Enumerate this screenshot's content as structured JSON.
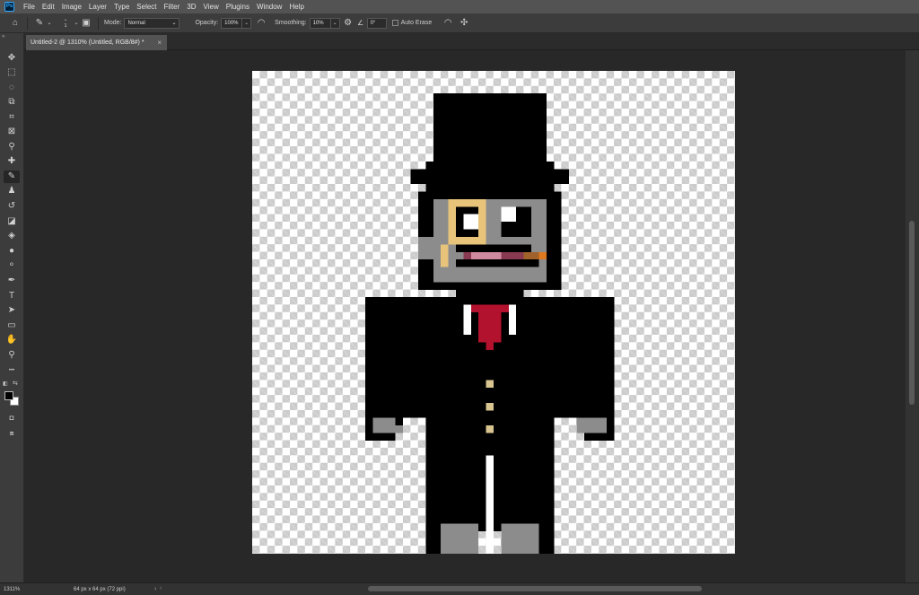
{
  "menu": [
    "File",
    "Edit",
    "Image",
    "Layer",
    "Type",
    "Select",
    "Filter",
    "3D",
    "View",
    "Plugins",
    "Window",
    "Help"
  ],
  "logo_text": "Ps",
  "options": {
    "brush_size": "1",
    "mode_label": "Mode:",
    "mode_value": "Normal",
    "opacity_label": "Opacity:",
    "opacity_value": "100%",
    "smoothing_label": "Smoothing:",
    "smoothing_value": "10%",
    "angle_value": "0°",
    "auto_erase_label": "Auto Erase"
  },
  "document": {
    "tab_title": "Untitled-2 @ 1310% (Untitled, RGB/8#) *",
    "close_glyph": "×"
  },
  "status": {
    "zoom": "1311%",
    "doc_info": "64 px x 64 px (72 ppi)",
    "arrow_glyph": "›"
  },
  "tools": [
    {
      "name": "move-tool",
      "glyph": "✥"
    },
    {
      "name": "marquee-tool",
      "glyph": "⬚"
    },
    {
      "name": "lasso-tool",
      "glyph": "◌"
    },
    {
      "name": "object-select-tool",
      "glyph": "⧉"
    },
    {
      "name": "crop-tool",
      "glyph": "⌗"
    },
    {
      "name": "frame-tool",
      "glyph": "⊠"
    },
    {
      "name": "eyedropper-tool",
      "glyph": "⚲"
    },
    {
      "name": "healing-tool",
      "glyph": "✚"
    },
    {
      "name": "pencil-tool",
      "glyph": "✎"
    },
    {
      "name": "stamp-tool",
      "glyph": "♟"
    },
    {
      "name": "history-brush-tool",
      "glyph": "↺"
    },
    {
      "name": "eraser-tool",
      "glyph": "◪"
    },
    {
      "name": "paint-bucket-tool",
      "glyph": "◈"
    },
    {
      "name": "blur-tool",
      "glyph": "●"
    },
    {
      "name": "dodge-tool",
      "glyph": "⚬"
    },
    {
      "name": "pen-tool",
      "glyph": "✒"
    },
    {
      "name": "type-tool",
      "glyph": "T"
    },
    {
      "name": "path-select-tool",
      "glyph": "➤"
    },
    {
      "name": "rectangle-tool",
      "glyph": "▭"
    },
    {
      "name": "hand-tool",
      "glyph": "✋"
    },
    {
      "name": "zoom-tool",
      "glyph": "⚲"
    },
    {
      "name": "more-tools",
      "glyph": "•••"
    }
  ],
  "colors": {
    "foreground": "#000000",
    "background": "#ffffff",
    "suit": "#000000",
    "skin": "#8c8c8c",
    "monocle": "#e8c47a",
    "tie": "#b3122e",
    "shirt": "#ffffff",
    "mouth": "#8a3a50",
    "lip": "#d08aa0",
    "cigar": "#a0622a",
    "cigar_tip": "#e07820",
    "buttons": "#d8c590",
    "gray_shoe": "#8c8c8c"
  }
}
